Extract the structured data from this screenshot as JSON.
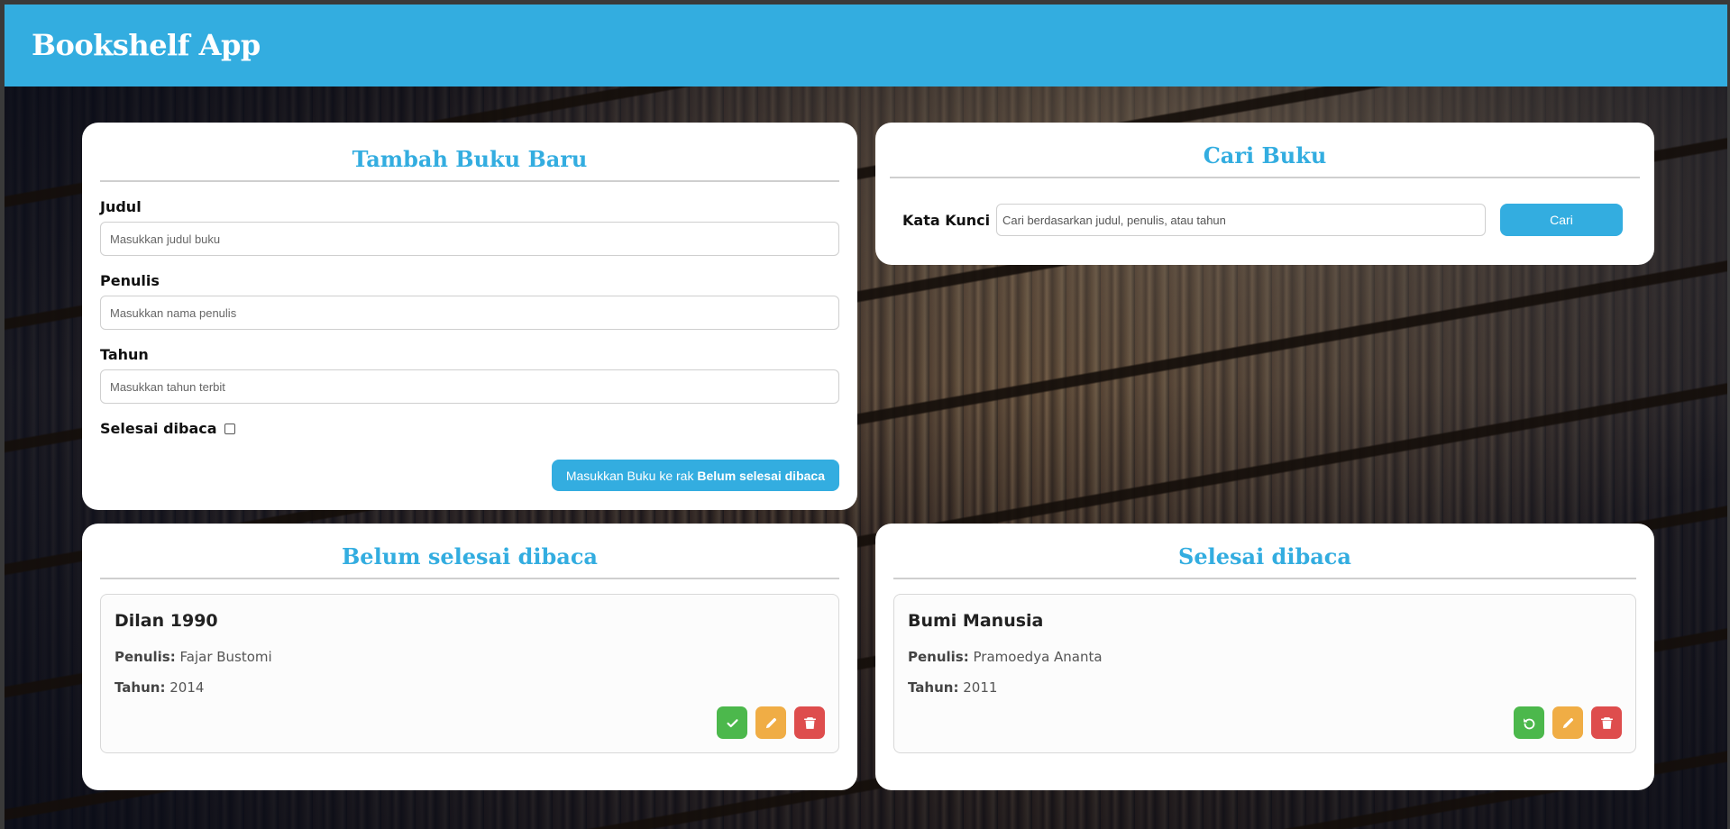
{
  "header": {
    "title": "Bookshelf App"
  },
  "add_form": {
    "title": "Tambah Buku Baru",
    "title_label": "Judul",
    "title_placeholder": "Masukkan judul buku",
    "author_label": "Penulis",
    "author_placeholder": "Masukkan nama penulis",
    "year_label": "Tahun",
    "year_placeholder": "Masukkan tahun terbit",
    "complete_label": "Selesai dibaca",
    "complete_checked": false,
    "submit_prefix": "Masukkan Buku ke rak ",
    "submit_shelf": "Belum selesai dibaca"
  },
  "search": {
    "title": "Cari Buku",
    "label": "Kata Kunci",
    "placeholder": "Cari berdasarkan judul, penulis, atau tahun",
    "button": "Cari"
  },
  "shelves": {
    "incomplete": {
      "title": "Belum selesai dibaca",
      "books": [
        {
          "title": "Dilan 1990",
          "author_label": "Penulis:",
          "author": "Fajar Bustomi",
          "year_label": "Tahun:",
          "year": "2014"
        }
      ]
    },
    "complete": {
      "title": "Selesai dibaca",
      "books": [
        {
          "title": "Bumi Manusia",
          "author_label": "Penulis:",
          "author": "Pramoedya Ananta",
          "year_label": "Tahun:",
          "year": "2011"
        }
      ]
    }
  },
  "colors": {
    "primary": "#33ade0",
    "complete_action": "#4cb84c",
    "edit_action": "#f0ad45",
    "delete_action": "#de4d4d"
  },
  "icons": [
    "check-icon",
    "undo-icon",
    "pencil-icon",
    "trash-icon"
  ]
}
